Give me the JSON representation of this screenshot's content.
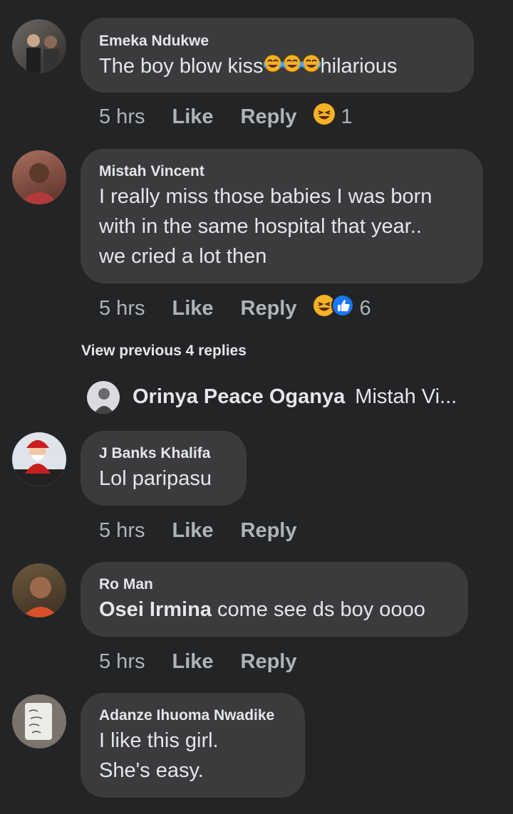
{
  "comments": [
    {
      "author": "Emeka Ndukwe",
      "text_before": "The boy blow kiss",
      "text_after": "hilarious",
      "time": "5 hrs",
      "like": "Like",
      "reply": "Reply",
      "reaction_count": "1"
    },
    {
      "author": "Mistah Vincent",
      "lines": [
        "I really miss those babies I was born",
        "with in the same hospital that year..",
        "we cried a lot then"
      ],
      "time": "5 hrs",
      "like": "Like",
      "reply": "Reply",
      "reaction_count": "6"
    },
    {
      "author": "J Banks Khalifa",
      "text": "Lol paripasu",
      "time": "5 hrs",
      "like": "Like",
      "reply": "Reply"
    },
    {
      "author": "Ro Man",
      "mention": "Osei Irmina",
      "text": " come see ds boy oooo",
      "time": "5 hrs",
      "like": "Like",
      "reply": "Reply"
    },
    {
      "author": "Adanze Ihuoma Nwadike",
      "lines": [
        "I like this girl.",
        "She's easy."
      ]
    }
  ],
  "view_previous": "View previous 4 replies",
  "reply_preview": {
    "author": "Orinya Peace Oganya",
    "text": "Mistah Vi..."
  },
  "colors": {
    "background": "#232426",
    "bubble": "#3a3b3c",
    "text": "#e4e6eb",
    "muted": "#b0b3b8",
    "haha": "#f7b125",
    "like": "#1877f2"
  },
  "icons": [
    "haha-emoji-icon",
    "tears-of-joy-emoji-icon",
    "like-reaction-icon"
  ]
}
